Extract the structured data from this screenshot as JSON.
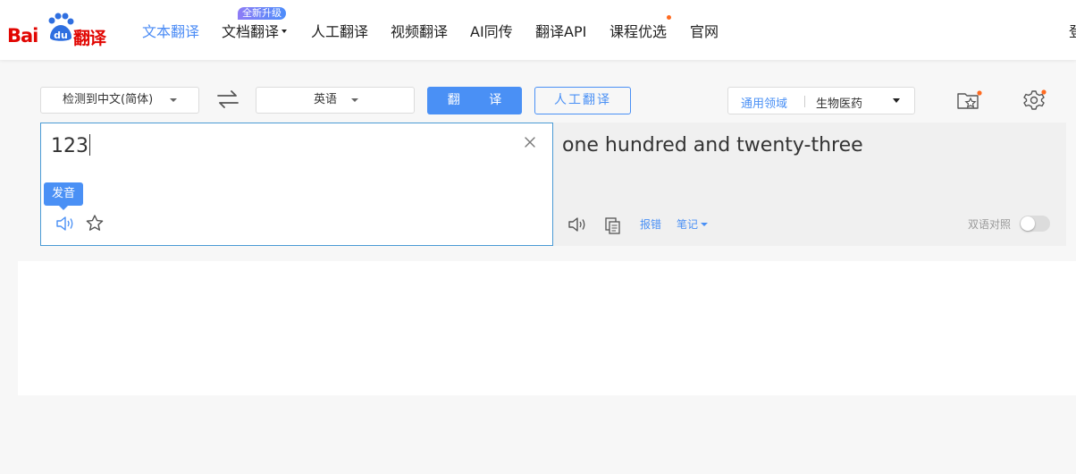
{
  "brand": {
    "logo_text_left": "Bai",
    "logo_text_paw": "du",
    "logo_text_right": "翻译",
    "color": "#e10602"
  },
  "nav": {
    "items": [
      {
        "label": "文本翻译",
        "active": true
      },
      {
        "label": "文档翻译",
        "dropdown": true
      },
      {
        "label": "人工翻译"
      },
      {
        "label": "视频翻译"
      },
      {
        "label": "AI同传"
      },
      {
        "label": "翻译API"
      },
      {
        "label": "课程优选",
        "dot": true
      },
      {
        "label": "官网"
      }
    ],
    "badge": "全新升级",
    "login_partial": "登"
  },
  "toolbar": {
    "source_lang": "检测到中文(简体)",
    "target_lang": "英语",
    "translate_label": "翻 译",
    "human_label": "人工翻译",
    "domain_general": "通用领域",
    "domain_selected": "生物医药"
  },
  "source": {
    "text": "123",
    "tooltip": "发音"
  },
  "target": {
    "text": "one hundred and twenty-three",
    "report_label": "报错",
    "notes_label": "笔记",
    "bilingual_label": "双语对照",
    "bilingual_on": false
  },
  "colors": {
    "accent": "#4a90f5",
    "border_active": "#4a9ad4",
    "badge_dot": "#ff6a1f"
  }
}
